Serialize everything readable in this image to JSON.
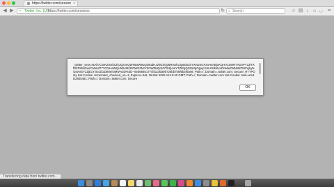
{
  "window": {
    "tab_label": "https://twitter.com/sessions",
    "tab_close": "×"
  },
  "toolbar": {
    "back_icon": "◀",
    "forward_icon": "▶",
    "secure_label": "Twitter, Inc. (US)",
    "url": "https://twitter.com/sessions",
    "search_placeholder": "Search",
    "menu_icon": "≡"
  },
  "dialog": {
    "message": "_twitter_sess=BAh7CSIKZmxhc2hJQzonQWN0aW9uQ29udHJvbGxlcjo6Rmxhc2g6OkZsYXNoSGFzaHsABjoKQHVzZWR7ADoPY3JlYXRlZF9hdGwrCMx6d77TAToHaWQiJWIxM2ZiOWE3NzY0OWZkZjc5OTlkZjAwYTZkNjQ3ZmNjOgxjc3JmX2lkIiUxZmMwZWNkMTM3YjkyNGIwNGY2ZjE1YzE4ZGZkMmI0Mw%3D%3D--5ed6665177cfd1cd0a9b726bb756f6b3f0ae8; Path=/; Domain=.twitter.com; Secure; HTTPOnly\nSet-Cookie: remember_checked_on=1; Expires=Sat, 15 Mar 2025 11:13:40 GMT; Path=/; Domain=.twitter.com\nSet-Cookie: twid=u%3D2845481; Path=/; Domain=.twitter.com; Secure",
    "ok_label": "OK"
  },
  "status_bar": {
    "text": "Transferring data from twitter.com..."
  },
  "dock": {
    "icons": [
      "finder-icon",
      "launchpad-icon",
      "safari-icon",
      "mail-icon",
      "contacts-icon",
      "calendar-icon",
      "notes-icon",
      "reminders-icon",
      "maps-icon",
      "photos-icon",
      "messages-icon",
      "facetime-icon",
      "itunes-icon",
      "ibooks-icon",
      "appstore-icon",
      "preferences-icon",
      "chrome-icon",
      "firefox-icon",
      "terminal-icon",
      "trash-icon"
    ]
  }
}
